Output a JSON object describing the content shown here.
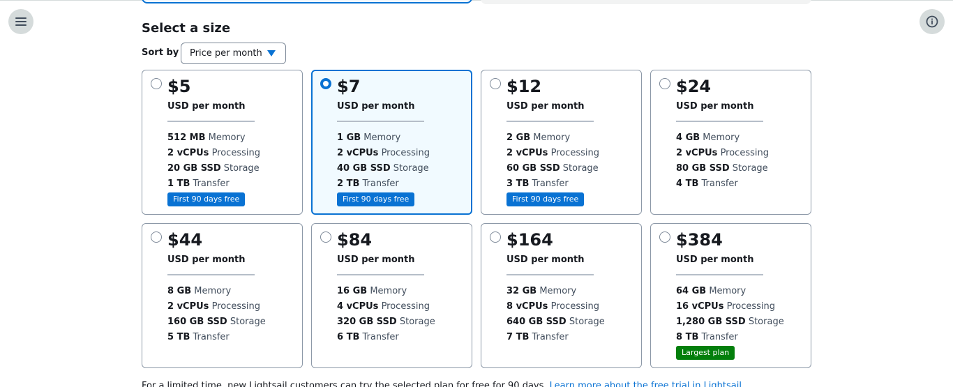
{
  "header": {
    "menu_icon": "hamburger-menu-icon",
    "info_icon": "info-icon"
  },
  "section": {
    "title": "Select a size",
    "sort_label": "Sort by",
    "sort_value": "Price per month"
  },
  "plans": [
    {
      "price": "$5",
      "unit": "USD per month",
      "memory": "512 MB",
      "cpu": "2 vCPUs",
      "storage": "20 GB SSD",
      "transfer": "1 TB",
      "badge": "First 90 days free",
      "selected": false
    },
    {
      "price": "$7",
      "unit": "USD per month",
      "memory": "1 GB",
      "cpu": "2 vCPUs",
      "storage": "40 GB SSD",
      "transfer": "2 TB",
      "badge": "First 90 days free",
      "selected": true
    },
    {
      "price": "$12",
      "unit": "USD per month",
      "memory": "2 GB",
      "cpu": "2 vCPUs",
      "storage": "60 GB SSD",
      "transfer": "3 TB",
      "badge": "First 90 days free",
      "selected": false
    },
    {
      "price": "$24",
      "unit": "USD per month",
      "memory": "4 GB",
      "cpu": "2 vCPUs",
      "storage": "80 GB SSD",
      "transfer": "4 TB",
      "badge": "",
      "selected": false
    },
    {
      "price": "$44",
      "unit": "USD per month",
      "memory": "8 GB",
      "cpu": "2 vCPUs",
      "storage": "160 GB SSD",
      "transfer": "5 TB",
      "badge": "",
      "selected": false
    },
    {
      "price": "$84",
      "unit": "USD per month",
      "memory": "16 GB",
      "cpu": "4 vCPUs",
      "storage": "320 GB SSD",
      "transfer": "6 TB",
      "badge": "",
      "selected": false
    },
    {
      "price": "$164",
      "unit": "USD per month",
      "memory": "32 GB",
      "cpu": "8 vCPUs",
      "storage": "640 GB SSD",
      "transfer": "7 TB",
      "badge": "",
      "selected": false
    },
    {
      "price": "$384",
      "unit": "USD per month",
      "memory": "64 GB",
      "cpu": "16 vCPUs",
      "storage": "1,280 GB SSD",
      "transfer": "8 TB",
      "badge": "Largest plan",
      "badge_color": "green",
      "selected": false
    }
  ],
  "spec_labels": {
    "memory": "Memory",
    "cpu": "Processing",
    "storage": "Storage",
    "transfer": "Transfer"
  },
  "footer": {
    "text": "For a limited time, new Lightsail customers can try the selected plan for free for 90 days.",
    "link": "Learn more about the free trial in Lightsail"
  },
  "colors": {
    "accent": "#0972d3",
    "badge_blue": "#0972d3",
    "badge_green": "#037f0c",
    "selected_bg": "#f1faff"
  }
}
